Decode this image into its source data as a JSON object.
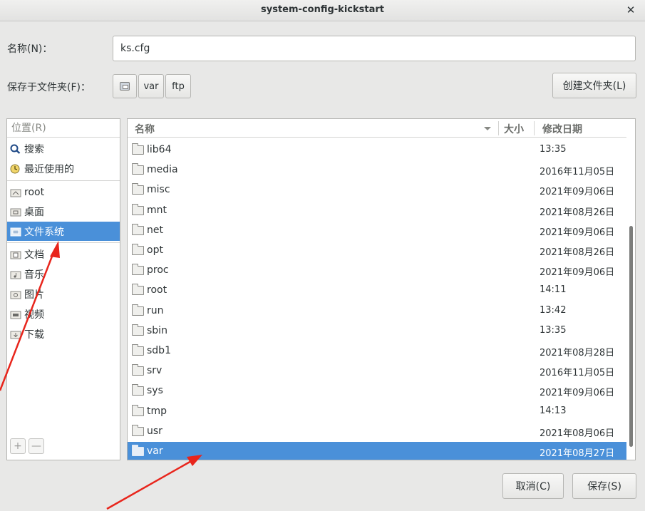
{
  "window": {
    "title": "system-config-kickstart"
  },
  "name_field": {
    "label": "名称(N)：",
    "value": "ks.cfg"
  },
  "save_in": {
    "label": "保存于文件夹(F)：",
    "path": [
      "var",
      "ftp"
    ]
  },
  "create_folder_label": "创建文件夹(L)",
  "places": {
    "header": "位置(R)",
    "items": [
      {
        "label": "搜索",
        "icon": "search-icon"
      },
      {
        "label": "最近使用的",
        "icon": "recent-icon"
      },
      {
        "label": "root",
        "icon": "home-folder-icon"
      },
      {
        "label": "桌面",
        "icon": "desktop-folder-icon"
      },
      {
        "label": "文件系统",
        "icon": "drive-icon",
        "selected": true
      },
      {
        "label": "文档",
        "icon": "documents-folder-icon"
      },
      {
        "label": "音乐",
        "icon": "music-folder-icon"
      },
      {
        "label": "图片",
        "icon": "pictures-folder-icon"
      },
      {
        "label": "视频",
        "icon": "videos-folder-icon"
      },
      {
        "label": "下载",
        "icon": "downloads-folder-icon"
      }
    ],
    "add_label": "+",
    "remove_label": "—"
  },
  "files": {
    "columns": {
      "name": "名称",
      "size": "大小",
      "modified": "修改日期"
    },
    "rows": [
      {
        "name": "lib64",
        "modified": "13:35"
      },
      {
        "name": "media",
        "modified": "2016年11月05日"
      },
      {
        "name": "misc",
        "modified": "2021年09月06日"
      },
      {
        "name": "mnt",
        "modified": "2021年08月26日"
      },
      {
        "name": "net",
        "modified": "2021年09月06日"
      },
      {
        "name": "opt",
        "modified": "2021年08月26日"
      },
      {
        "name": "proc",
        "modified": "2021年09月06日"
      },
      {
        "name": "root",
        "modified": "14:11"
      },
      {
        "name": "run",
        "modified": "13:42"
      },
      {
        "name": "sbin",
        "modified": "13:35"
      },
      {
        "name": "sdb1",
        "modified": "2021年08月28日"
      },
      {
        "name": "srv",
        "modified": "2016年11月05日"
      },
      {
        "name": "sys",
        "modified": "2021年09月06日"
      },
      {
        "name": "tmp",
        "modified": "14:13"
      },
      {
        "name": "usr",
        "modified": "2021年08月06日"
      },
      {
        "name": "var",
        "modified": "2021年08月27日",
        "selected": true
      }
    ]
  },
  "actions": {
    "cancel": "取消(C)",
    "save": "保存(S)"
  },
  "colors": {
    "selection": "#4a90d9",
    "annotation_arrow": "#e8251c"
  }
}
